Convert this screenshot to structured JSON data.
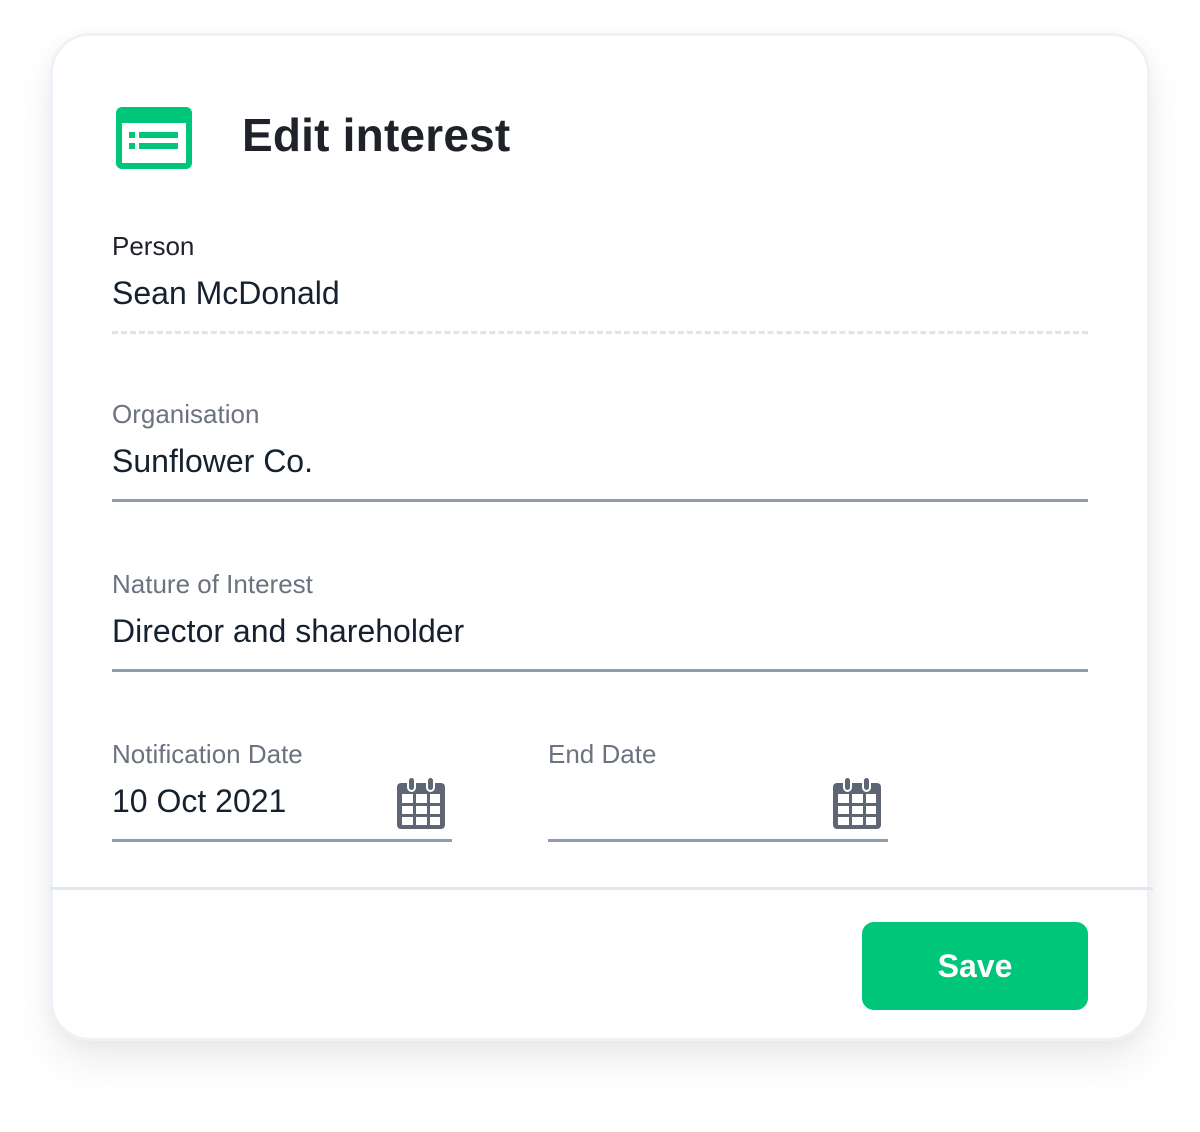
{
  "dialog": {
    "title": "Edit interest",
    "icon": "form-list-icon",
    "accent_color": "#00c67a"
  },
  "fields": {
    "person": {
      "label": "Person",
      "value": "Sean McDonald",
      "readonly": true
    },
    "organisation": {
      "label": "Organisation",
      "value": "Sunflower Co."
    },
    "nature_of_interest": {
      "label": "Nature of Interest",
      "value": "Director and shareholder"
    },
    "notification_date": {
      "label": "Notification Date",
      "value": "10 Oct 2021",
      "icon": "calendar-icon"
    },
    "end_date": {
      "label": "End Date",
      "value": "",
      "icon": "calendar-icon"
    }
  },
  "footer": {
    "save_label": "Save"
  }
}
